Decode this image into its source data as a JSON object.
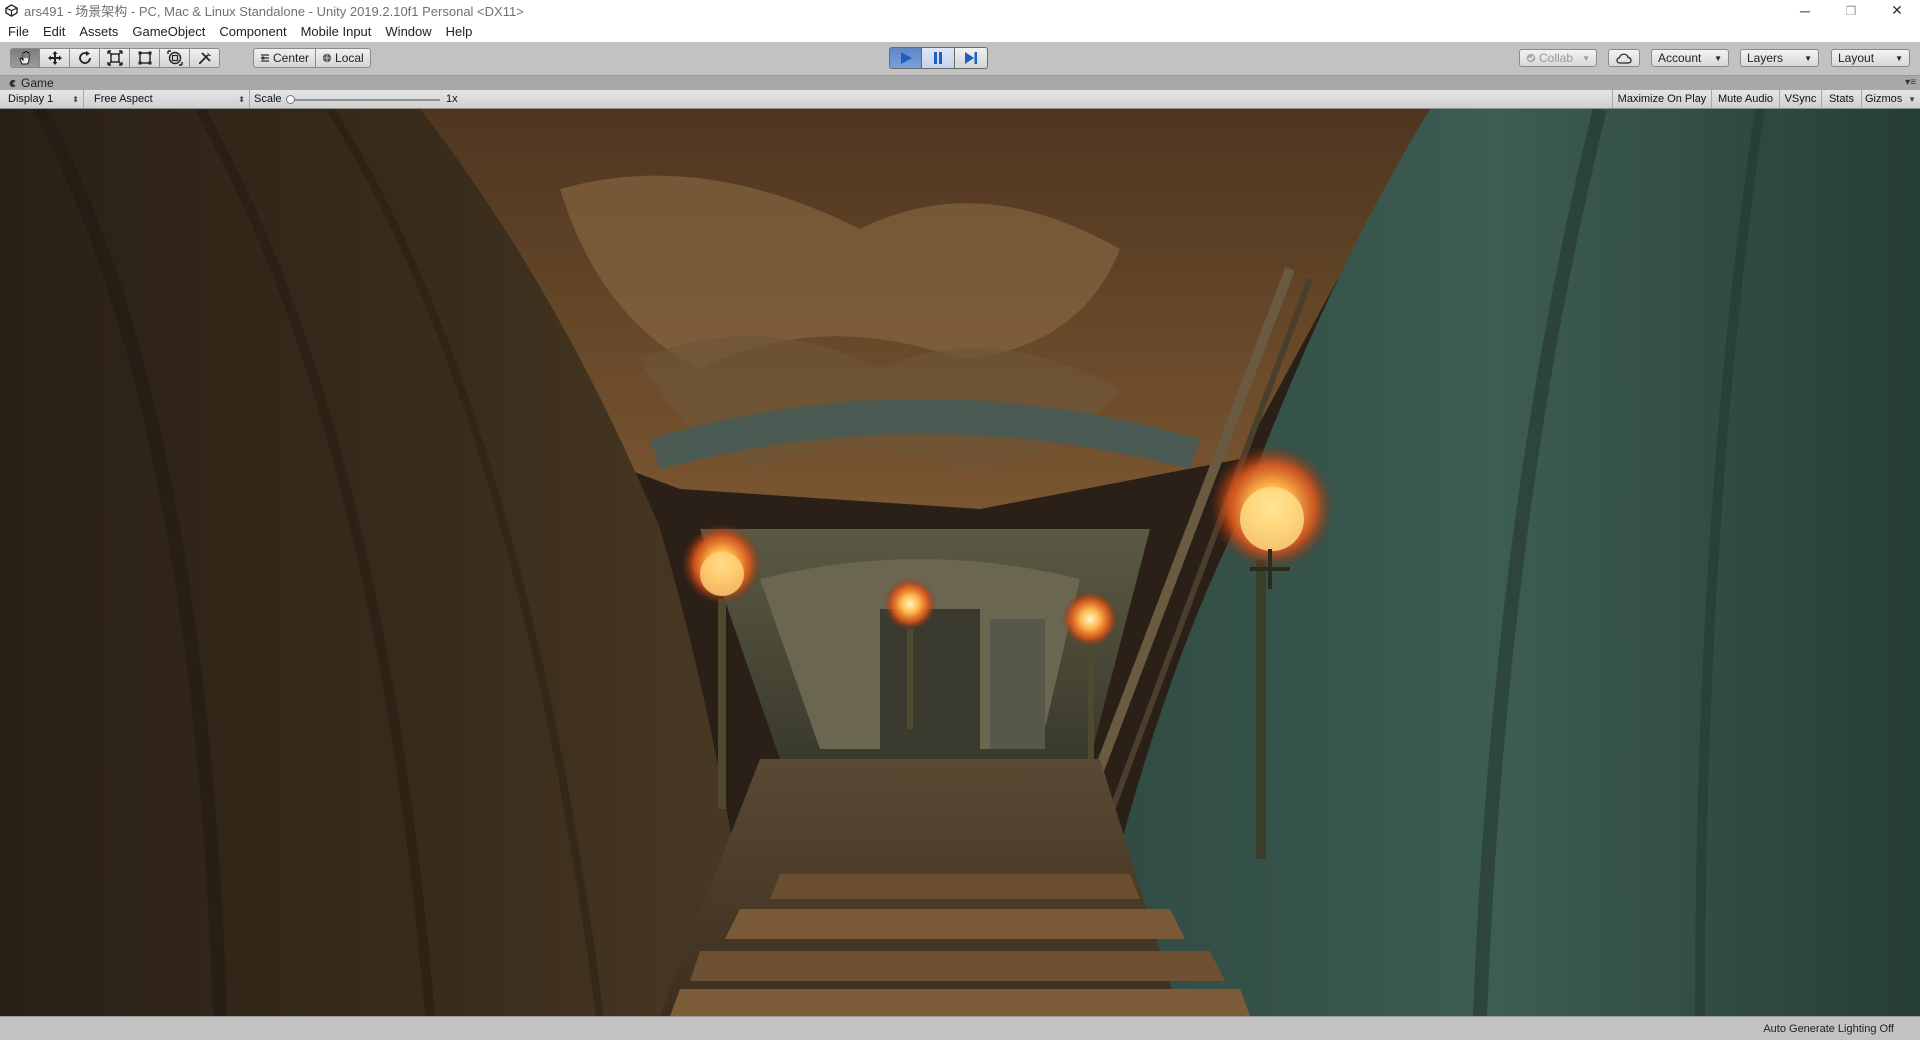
{
  "window": {
    "title": "ars491 - 场景架构 - PC, Mac & Linux Standalone - Unity 2019.2.10f1 Personal <DX11>",
    "minimize_glyph": "─",
    "restore_glyph": "❐",
    "close_glyph": "✕"
  },
  "menu": [
    "File",
    "Edit",
    "Assets",
    "GameObject",
    "Component",
    "Mobile Input",
    "Window",
    "Help"
  ],
  "toolbar": {
    "tools": [
      "hand-icon",
      "move-icon",
      "rotate-icon",
      "scale-icon",
      "rect-icon",
      "transform-icon",
      "custom-tool-icon"
    ],
    "active_tool": "hand-icon",
    "pivot_label": "Center",
    "space_label": "Local",
    "play_active": true,
    "pause_active": true,
    "accent": "#5d86c8",
    "collab_label": "Collab",
    "account_label": "Account",
    "layers_label": "Layers",
    "layout_label": "Layout"
  },
  "game_tab": {
    "label": "Game"
  },
  "game_toolbar": {
    "display": "Display 1",
    "aspect": "Free Aspect",
    "scale_label": "Scale",
    "scale_value": "1x",
    "scale_fraction": 0.0,
    "maximize_on_play": "Maximize On Play",
    "mute_audio": "Mute Audio",
    "vsync": "VSync",
    "stats": "Stats",
    "gizmos": "Gizmos"
  },
  "status": {
    "lighting": "Auto Generate Lighting Off"
  }
}
